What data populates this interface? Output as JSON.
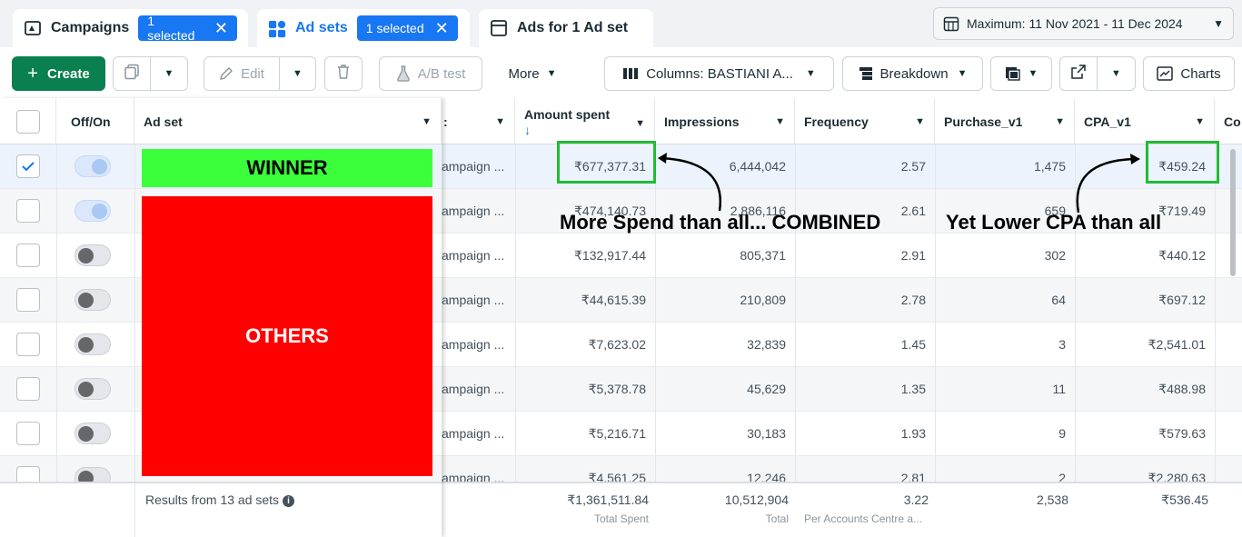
{
  "tabs": [
    {
      "label": "Campaigns",
      "pill": "1 selected",
      "icon": "folder-icon"
    },
    {
      "label": "Ad sets",
      "pill": "1 selected",
      "icon": "grid-icon"
    },
    {
      "label": "Ads for 1 Ad set",
      "icon": "ad-icon"
    }
  ],
  "date_range": "Maximum: 11 Nov 2021 - 11 Dec 2024",
  "toolbar": {
    "create": "Create",
    "edit": "Edit",
    "ab_test": "A/B test",
    "more": "More",
    "columns": "Columns: BASTIANI A...",
    "breakdown": "Breakdown",
    "charts": "Charts"
  },
  "columns": {
    "off_on": "Off/On",
    "ad_set": "Ad set",
    "amount_spent": "Amount spent",
    "impressions": "Impressions",
    "frequency": "Frequency",
    "purchase": "Purchase_v1",
    "cpa": "CPA_v1",
    "more": "Co"
  },
  "rows": [
    {
      "campaign": "ampaign ...",
      "spent": "₹677,377.31",
      "impressions": "6,444,042",
      "frequency": "2.57",
      "purchase": "1,475",
      "cpa": "₹459.24",
      "selected": true,
      "on": true
    },
    {
      "campaign": "ampaign ...",
      "spent": "₹474,140.73",
      "impressions": "2,886,116",
      "frequency": "2.61",
      "purchase": "659",
      "cpa": "₹719.49",
      "selected": false,
      "on": true
    },
    {
      "campaign": "ampaign ...",
      "spent": "₹132,917.44",
      "impressions": "805,371",
      "frequency": "2.91",
      "purchase": "302",
      "cpa": "₹440.12",
      "selected": false,
      "on": false
    },
    {
      "campaign": "ampaign ...",
      "spent": "₹44,615.39",
      "impressions": "210,809",
      "frequency": "2.78",
      "purchase": "64",
      "cpa": "₹697.12",
      "selected": false,
      "on": false
    },
    {
      "campaign": "ampaign ...",
      "spent": "₹7,623.02",
      "impressions": "32,839",
      "frequency": "1.45",
      "purchase": "3",
      "cpa": "₹2,541.01",
      "selected": false,
      "on": false
    },
    {
      "campaign": "ampaign ...",
      "spent": "₹5,378.78",
      "impressions": "45,629",
      "frequency": "1.35",
      "purchase": "11",
      "cpa": "₹488.98",
      "selected": false,
      "on": false
    },
    {
      "campaign": "ampaign ...",
      "spent": "₹5,216.71",
      "impressions": "30,183",
      "frequency": "1.93",
      "purchase": "9",
      "cpa": "₹579.63",
      "selected": false,
      "on": false
    },
    {
      "campaign": "ampaign ...",
      "spent": "₹4,561.25",
      "impressions": "12,246",
      "frequency": "2.81",
      "purchase": "2",
      "cpa": "₹2,280.63",
      "selected": false,
      "on": false
    }
  ],
  "footer": {
    "results": "Results from 13 ad sets",
    "spent": "₹1,361,511.84",
    "spent_sub": "Total Spent",
    "impressions": "10,512,904",
    "impressions_sub": "Total",
    "frequency": "3.22",
    "frequency_sub": "Per Accounts Centre a...",
    "purchase": "2,538",
    "cpa": "₹536.45"
  },
  "annotations": {
    "winner": "WINNER",
    "others": "OTHERS",
    "spend_note": "More Spend than all... COMBINED",
    "cpa_note": "Yet Lower CPA than all"
  },
  "colors": {
    "accent": "#1877f2",
    "create_green": "#0a7f4f",
    "winner_green": "#3bff3b",
    "others_red": "#ff0000",
    "highlight_box": "#22bb33"
  }
}
